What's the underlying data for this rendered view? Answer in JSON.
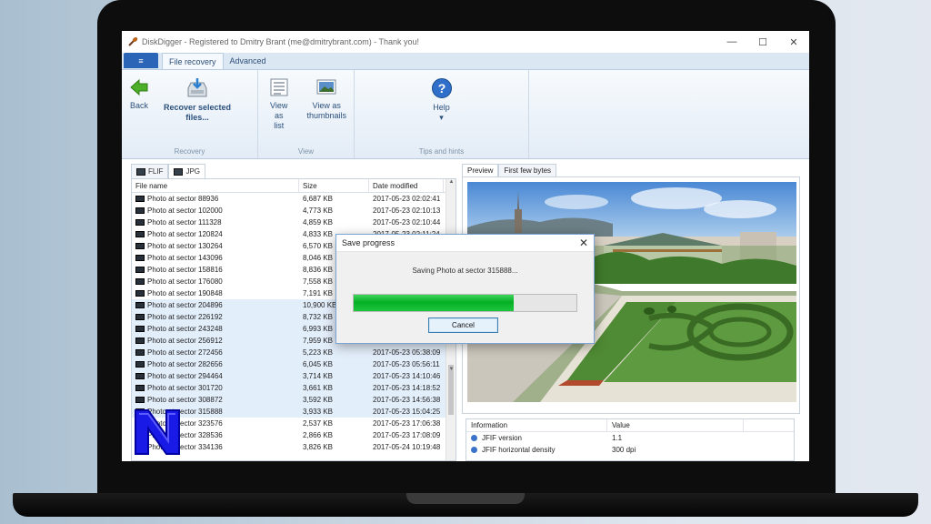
{
  "window": {
    "title": "DiskDigger - Registered to Dmitry Brant (me@dmitrybrant.com) - Thank you!",
    "controls": [
      "—",
      "☐",
      "✕"
    ]
  },
  "ribbon": {
    "file_menu_label": "",
    "tabs": [
      "File recovery",
      "Advanced"
    ],
    "back_label": "Back",
    "recover_label_1": "Recover selected",
    "recover_label_2": "files...",
    "recovery_group": "Recovery",
    "view_list_1": "View as",
    "view_list_2": "list",
    "view_thumbs_1": "View as",
    "view_thumbs_2": "thumbnails",
    "view_group": "View",
    "help_label": "Help",
    "help_arrow": "▾",
    "tips_group": "Tips and hints"
  },
  "type_tabs": [
    "FLIF",
    "JPG"
  ],
  "filelist": {
    "columns": [
      "File name",
      "Size",
      "Date modified"
    ],
    "rows": [
      {
        "name": "Photo at sector 88936",
        "size": "6,687 KB",
        "date": "2017-05-23 02:02:41"
      },
      {
        "name": "Photo at sector 102000",
        "size": "4,773 KB",
        "date": "2017-05-23 02:10:13"
      },
      {
        "name": "Photo at sector 111328",
        "size": "4,859 KB",
        "date": "2017-05-23 02:10:44"
      },
      {
        "name": "Photo at sector 120824",
        "size": "4,833 KB",
        "date": "2017-05-23 02:11:24"
      },
      {
        "name": "Photo at sector 130264",
        "size": "6,570 KB",
        "date": "2017-05-23 02:13:00"
      },
      {
        "name": "Photo at sector 143096",
        "size": "8,046 KB",
        "date": "2017-05-23 02:14:21"
      },
      {
        "name": "Photo at sector 158816",
        "size": "8,836 KB",
        "date": "2017-05-23 02:15:03"
      },
      {
        "name": "Photo at sector 176080",
        "size": "7,558 KB",
        "date": "2017-05-23 02:16:37"
      },
      {
        "name": "Photo at sector 190848",
        "size": "7,191 KB",
        "date": "2017-05-23 02:17:50"
      },
      {
        "name": "Photo at sector 204896",
        "size": "10,900 KB",
        "date": "2017-05-23 02:18:26"
      },
      {
        "name": "Photo at sector 226192",
        "size": "8,732 KB",
        "date": "2017-05-23 02:19:11"
      },
      {
        "name": "Photo at sector 243248",
        "size": "6,993 KB",
        "date": "2017-05-23 02:20:45"
      },
      {
        "name": "Photo at sector 256912",
        "size": "7,959 KB",
        "date": "2017-05-23 02:21:18"
      },
      {
        "name": "Photo at sector 272456",
        "size": "5,223 KB",
        "date": "2017-05-23 05:38:09"
      },
      {
        "name": "Photo at sector 282656",
        "size": "6,045 KB",
        "date": "2017-05-23 05:56:11"
      },
      {
        "name": "Photo at sector 294464",
        "size": "3,714 KB",
        "date": "2017-05-23 14:10:46"
      },
      {
        "name": "Photo at sector 301720",
        "size": "3,661 KB",
        "date": "2017-05-23 14:18:52"
      },
      {
        "name": "Photo at sector 308872",
        "size": "3,592 KB",
        "date": "2017-05-23 14:56:38"
      },
      {
        "name": "Photo at sector 315888",
        "size": "3,933 KB",
        "date": "2017-05-23 15:04:25"
      },
      {
        "name": "Photo at sector 323576",
        "size": "2,537 KB",
        "date": "2017-05-23 17:06:38"
      },
      {
        "name": "Photo at sector 328536",
        "size": "2,866 KB",
        "date": "2017-05-23 17:08:09"
      },
      {
        "name": "Photo at sector 334136",
        "size": "3,826 KB",
        "date": "2017-05-24 10:19:48"
      }
    ]
  },
  "preview": {
    "tabs": [
      "Preview",
      "First few bytes"
    ],
    "info_columns": [
      "Information",
      "Value"
    ],
    "info_rows": [
      {
        "label": "JFIF version",
        "value": "1.1"
      },
      {
        "label": "JFIF horizontal density",
        "value": "300 dpi"
      }
    ]
  },
  "dialog": {
    "title": "Save progress",
    "close": "✕",
    "message": "Saving Photo at sector 315888...",
    "progress": 0.72,
    "cancel_label": "Cancel"
  },
  "colors": {
    "accent": "#2a65b8",
    "progress_green": "#06b025",
    "ribbon_bg": "#dbe7f3"
  }
}
